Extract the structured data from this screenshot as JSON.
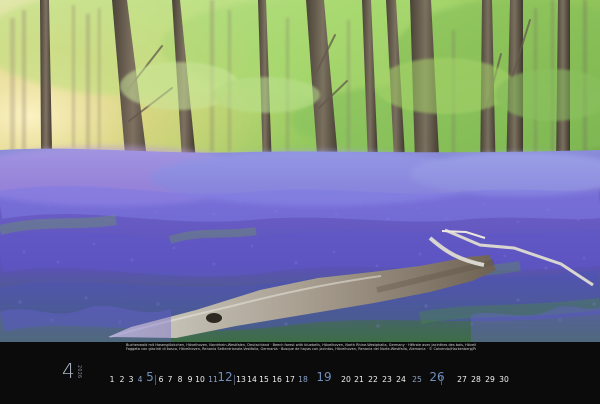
{
  "calendar": {
    "month_number": "4",
    "year": "2026",
    "caption_lines": [
      "Buchenwald mit Hasenglöckchen, Hövelhoven, Nordrhein-Westfalen, Deutschland · Beech forest with bluebells, Hövelhoven, North Rhine-Westphalia, Germany · Hêtraie avec jacinthes des bois, Hövelhoven, Rhénanie du Nord-Westphalie, Allemagne",
      "Faggeta con giacinti di bosco, Hövelhoven, Renania Settentrionale-Vestfalia, Germania · Bosque de hayas con jacintos, Hövelhoven, Renania del Norte-Westfalia, Alemania · © Calvendo/Hackenberg/Paris/Doppelganger"
    ],
    "days": [
      {
        "label": "1",
        "type": "weekday"
      },
      {
        "label": "2",
        "type": "weekday"
      },
      {
        "label": "3",
        "type": "weekday"
      },
      {
        "label": "4",
        "type": "saturday"
      },
      {
        "label": "5",
        "type": "sunday"
      },
      {
        "label": "6",
        "type": "weekday"
      },
      {
        "label": "7",
        "type": "weekday"
      },
      {
        "label": "8",
        "type": "weekday"
      },
      {
        "label": "9",
        "type": "weekday"
      },
      {
        "label": "10",
        "type": "weekday"
      },
      {
        "label": "11",
        "type": "saturday"
      },
      {
        "label": "12",
        "type": "sunday"
      },
      {
        "label": "13",
        "type": "weekday"
      },
      {
        "label": "14",
        "type": "weekday"
      },
      {
        "label": "15",
        "type": "weekday"
      },
      {
        "label": "16",
        "type": "weekday"
      },
      {
        "label": "17",
        "type": "weekday"
      },
      {
        "label": "18",
        "type": "saturday"
      },
      {
        "label": "19",
        "type": "sunday"
      },
      {
        "label": "20",
        "type": "weekday"
      },
      {
        "label": "21",
        "type": "weekday"
      },
      {
        "label": "22",
        "type": "weekday"
      },
      {
        "label": "23",
        "type": "weekday"
      },
      {
        "label": "24",
        "type": "weekday"
      },
      {
        "label": "25",
        "type": "saturday"
      },
      {
        "label": "26",
        "type": "sunday"
      },
      {
        "label": "27",
        "type": "weekday"
      },
      {
        "label": "28",
        "type": "weekday"
      },
      {
        "label": "29",
        "type": "weekday"
      },
      {
        "label": "30",
        "type": "weekday"
      }
    ]
  },
  "colors": {
    "background": "#0b0b0b",
    "weekday_text": "#f1f1f1",
    "weekend_text": "#6f8fbd",
    "month_text": "#aab4c4",
    "bluebell": "#6f5fd1",
    "forest_light": "#d8f0a8",
    "trunk": "#62584e"
  }
}
